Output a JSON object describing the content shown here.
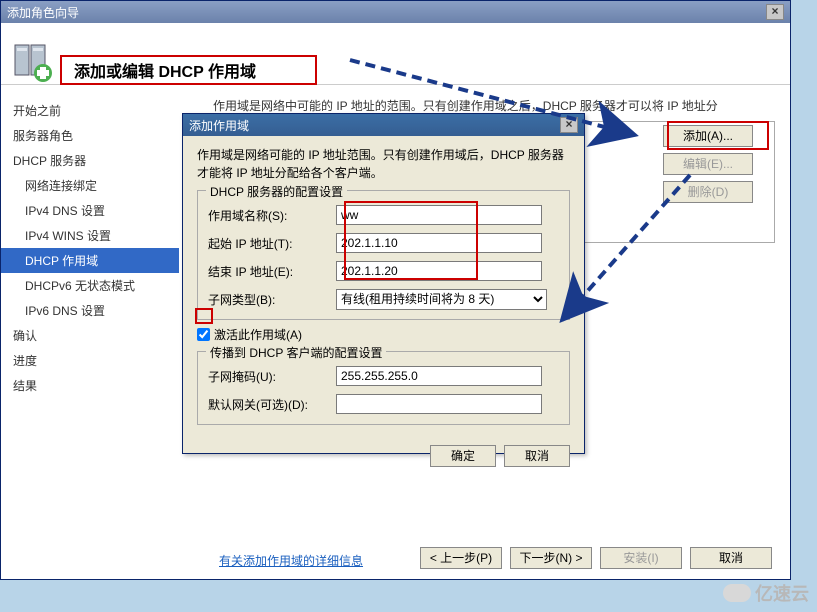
{
  "window": {
    "title": "添加角色向导",
    "header_title": "添加或编辑 DHCP 作用域",
    "close_glyph": "×"
  },
  "sidebar": {
    "items": [
      {
        "label": "开始之前",
        "level": 1,
        "selected": false
      },
      {
        "label": "服务器角色",
        "level": 1,
        "selected": false
      },
      {
        "label": "DHCP 服务器",
        "level": 1,
        "selected": false
      },
      {
        "label": "网络连接绑定",
        "level": 2,
        "selected": false
      },
      {
        "label": "IPv4 DNS 设置",
        "level": 2,
        "selected": false
      },
      {
        "label": "IPv4 WINS 设置",
        "level": 2,
        "selected": false
      },
      {
        "label": "DHCP 作用域",
        "level": 2,
        "selected": true
      },
      {
        "label": "DHCPv6 无状态模式",
        "level": 2,
        "selected": false
      },
      {
        "label": "IPv6 DNS 设置",
        "level": 2,
        "selected": false
      },
      {
        "label": "确认",
        "level": 1,
        "selected": false
      },
      {
        "label": "进度",
        "level": 1,
        "selected": false
      },
      {
        "label": "结果",
        "level": 1,
        "selected": false
      }
    ]
  },
  "main": {
    "description": "作用域是网络中可能的 IP 地址的范围。只有创建作用域之后，DHCP 服务器才可以将 IP 地址分",
    "actions": {
      "add": "添加(A)...",
      "edit": "编辑(E)...",
      "delete": "删除(D)"
    },
    "more_link": "有关添加作用域的详细信息"
  },
  "footer": {
    "prev": "< 上一步(P)",
    "next": "下一步(N) >",
    "install": "安装(I)",
    "cancel": "取消"
  },
  "dialog": {
    "title": "添加作用域",
    "description": "作用域是网络可能的 IP 地址范围。只有创建作用域后，DHCP 服务器才能将 IP 地址分配给各个客户端。",
    "group1_title": "DHCP 服务器的配置设置",
    "fields": {
      "scope_name_label": "作用域名称(S):",
      "scope_name_value": "ww",
      "start_ip_label": "起始 IP 地址(T):",
      "start_ip_value": "202.1.1.10",
      "end_ip_label": "结束 IP 地址(E):",
      "end_ip_value": "202.1.1.20",
      "subnet_type_label": "子网类型(B):",
      "subnet_type_value": "有线(租用持续时间将为 8 天)"
    },
    "activate_label": "激活此作用域(A)",
    "activate_checked": true,
    "group2_title": "传播到 DHCP 客户端的配置设置",
    "fields2": {
      "subnet_mask_label": "子网掩码(U):",
      "subnet_mask_value": "255.255.255.0",
      "gateway_label": "默认网关(可选)(D):",
      "gateway_value": ""
    },
    "ok": "确定",
    "cancel": "取消"
  },
  "watermark": "亿速云"
}
